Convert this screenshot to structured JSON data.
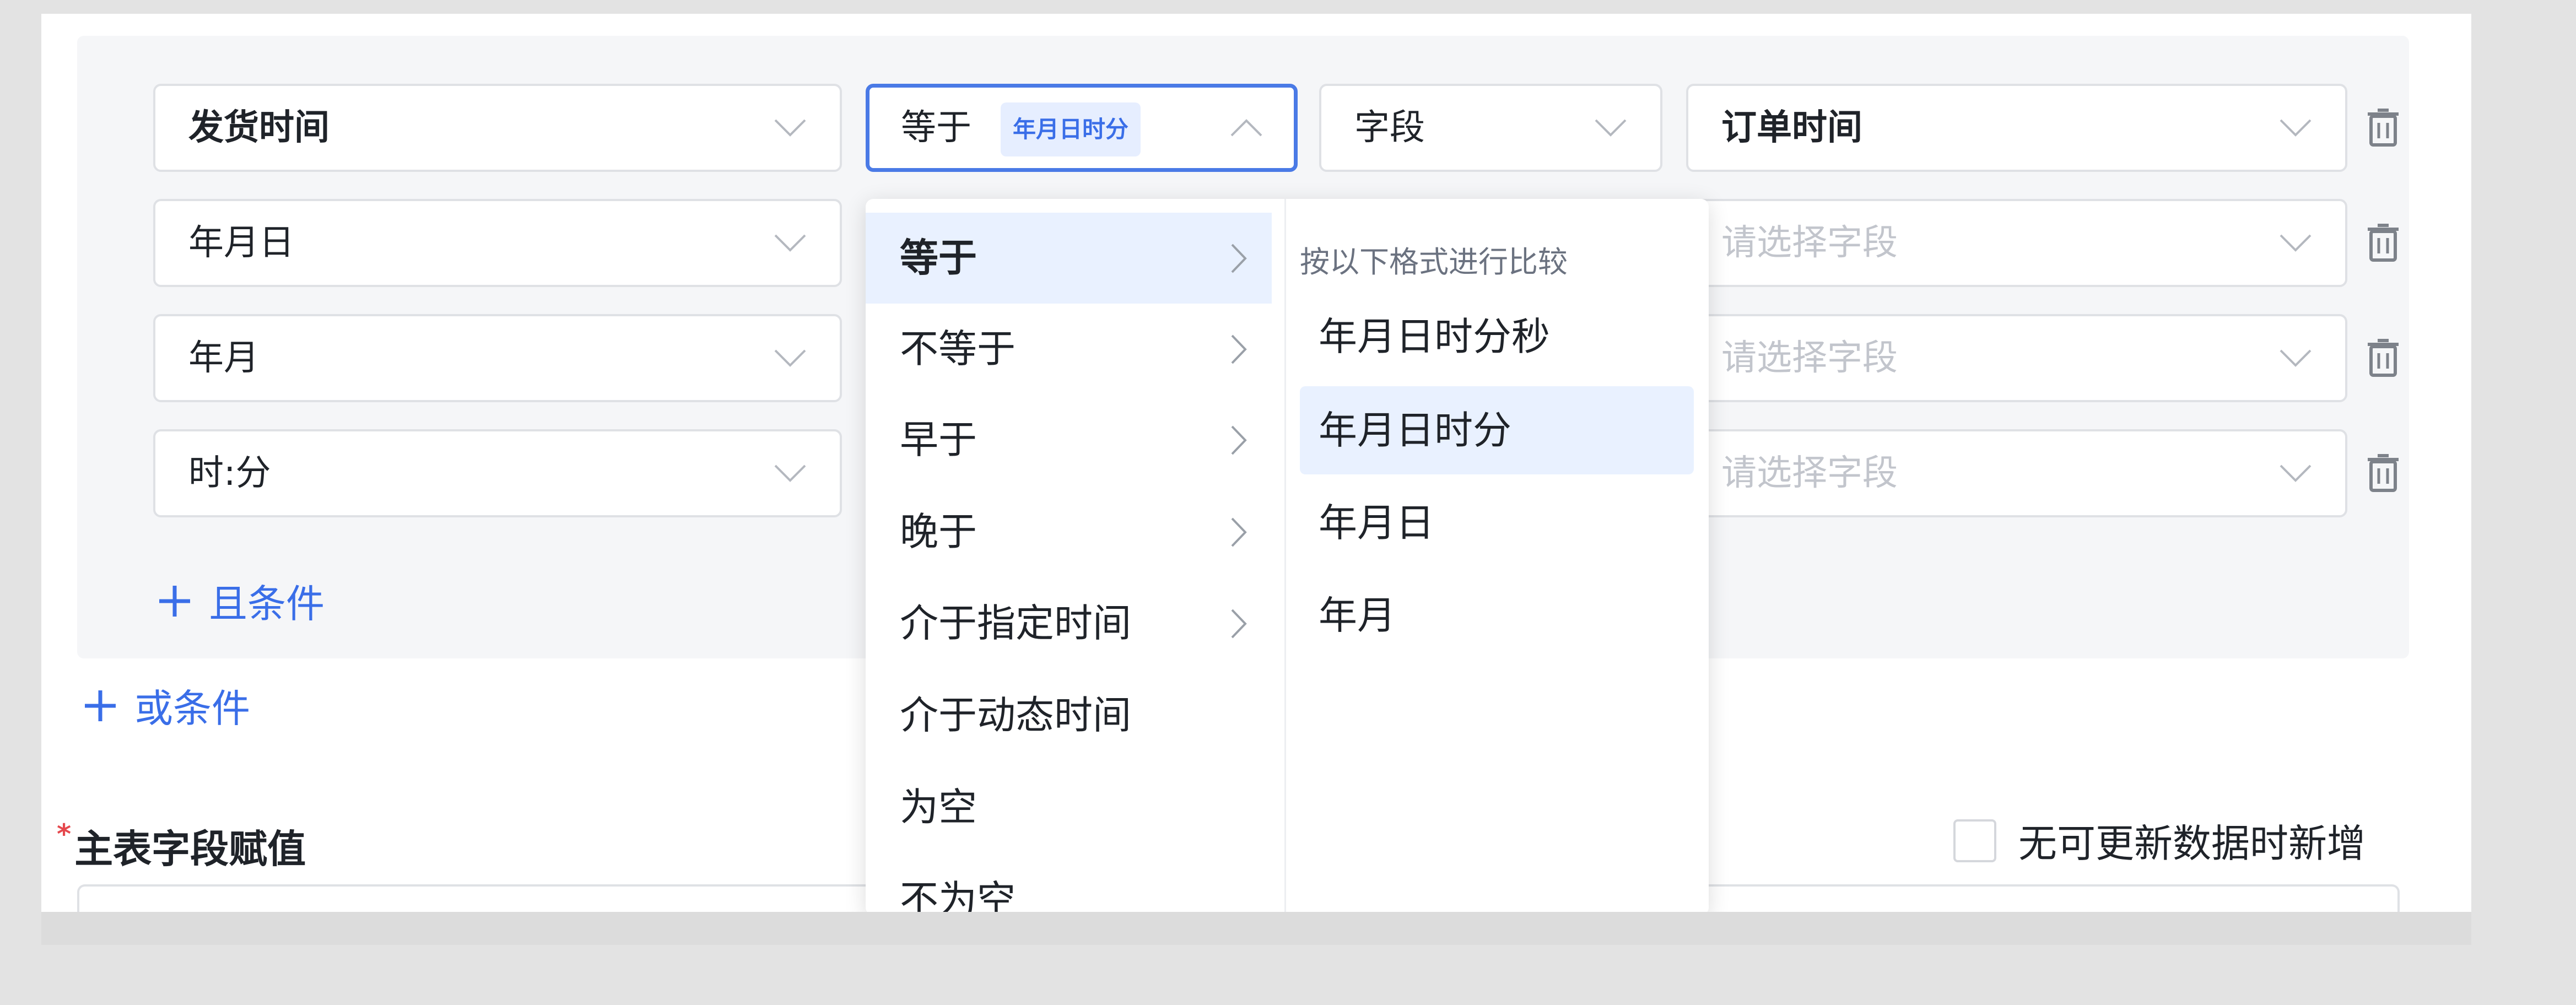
{
  "conditions": {
    "rows": [
      {
        "field": "发货时间",
        "field_bold": true,
        "operator": "等于",
        "format_tag": "年月日时分",
        "value_type": "字段",
        "value": "订单时间"
      },
      {
        "field": "年月日",
        "value_placeholder": "请选择字段"
      },
      {
        "field": "年月",
        "value_placeholder": "请选择字段"
      },
      {
        "field": "时:分",
        "value_placeholder": "请选择字段"
      }
    ],
    "and_link": "且条件",
    "or_link": "或条件"
  },
  "main_assign": {
    "label": "主表字段赋值",
    "required_mark": "*",
    "checkbox_label": "无可更新数据时新增"
  },
  "dropdown": {
    "operators": [
      {
        "label": "等于",
        "selected": true,
        "has_submenu": true
      },
      {
        "label": "不等于",
        "has_submenu": true
      },
      {
        "label": "早于",
        "has_submenu": true
      },
      {
        "label": "晚于",
        "has_submenu": true
      },
      {
        "label": "介于指定时间",
        "has_submenu": true
      },
      {
        "label": "介于动态时间",
        "has_submenu": false
      },
      {
        "label": "为空",
        "has_submenu": false
      },
      {
        "label": "不为空",
        "has_submenu": false
      }
    ],
    "format_header": "按以下格式进行比较",
    "formats": [
      {
        "label": "年月日时分秒"
      },
      {
        "label": "年月日时分",
        "selected": true
      },
      {
        "label": "年月日"
      },
      {
        "label": "年月"
      }
    ]
  },
  "colors": {
    "accent": "#3a6ee8",
    "active_border": "#4a7ae6",
    "selected_bg": "#e9f1ff",
    "required": "#e5484d"
  },
  "icons": {
    "chevron_down": "chevron-down-icon",
    "chevron_up": "chevron-up-icon",
    "chevron_right": "chevron-right-icon",
    "trash": "trash-icon",
    "plus": "plus-icon"
  }
}
